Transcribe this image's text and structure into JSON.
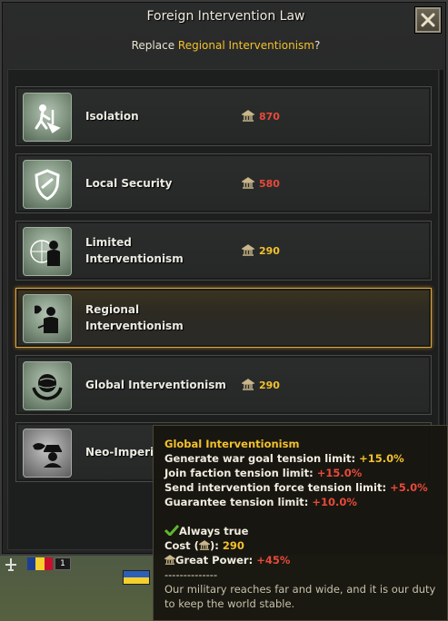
{
  "window": {
    "title": "Foreign Intervention Law",
    "subtitle_prefix": "Replace ",
    "subtitle_current": "Regional Interventionism",
    "subtitle_suffix": "?"
  },
  "laws": [
    {
      "name": "Isolation",
      "cost": "870",
      "cost_color": "#e74a3a",
      "icon": "isolation-icon"
    },
    {
      "name": "Local Security",
      "cost": "580",
      "cost_color": "#e74a3a",
      "icon": "shield-icon"
    },
    {
      "name": "Limited Interventionism",
      "cost": "290",
      "cost_color": "#f2c12e",
      "icon": "soldier-globe-icon"
    },
    {
      "name": "Regional Interventionism",
      "cost": "",
      "cost_color": "",
      "icon": "soldier-map-icon",
      "selected": true
    },
    {
      "name": "Global Interventionism",
      "cost": "290",
      "cost_color": "#f2c12e",
      "icon": "globe-hands-icon"
    },
    {
      "name": "Neo-Imperi",
      "cost": "",
      "cost_color": "",
      "icon": "spy-icon"
    }
  ],
  "tooltip": {
    "title": "Global Interventionism",
    "line1_label": "Generate war goal tension limit: ",
    "line1_value": "+15.0%",
    "line2_label": "Join faction tension limit: ",
    "line2_value": "+15.0%",
    "line3_label": "Send intervention force tension limit: ",
    "line3_value": "+5.0%",
    "line4_label": "Guarantee tension limit: ",
    "line4_value": "+10.0%",
    "always_true": "Always true",
    "cost_label_a": "Cost (",
    "cost_label_b": "): ",
    "cost_value": "290",
    "great_power_label": "Great Power: ",
    "great_power_value": "+45%",
    "separator": "--------------",
    "description": "Our military reaches far and wide, and it is our duty to keep the world stable."
  },
  "hud": {
    "unit_count": "1"
  },
  "colors": {
    "accent": "#f2c12e",
    "negative": "#e74a3a",
    "positive": "#9ee06a",
    "selected_border": "#d9a640"
  }
}
